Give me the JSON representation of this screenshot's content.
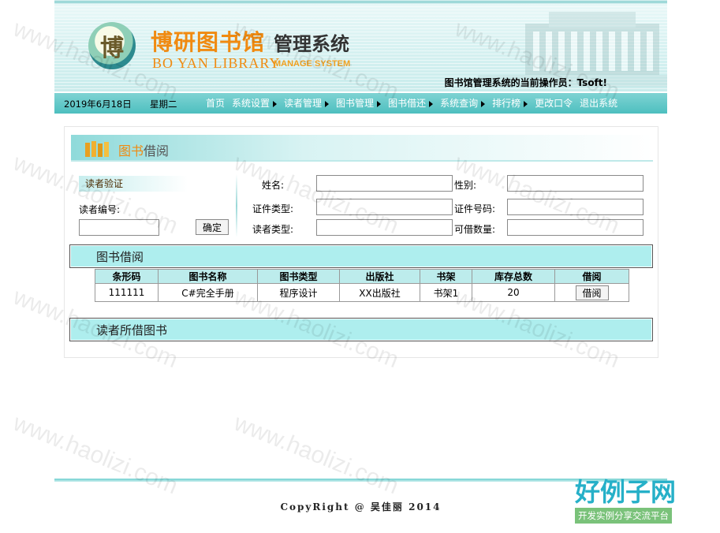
{
  "header": {
    "logo_seal": "博",
    "logo_cn": "博研图书馆",
    "logo_cn_suffix": "管理系统",
    "logo_en": "BO YAN LIBRARY",
    "logo_en_suffix": "MANAGE SYSTEM",
    "operator_text": "图书馆管理系统的当前操作员：Tsoft!"
  },
  "navbar": {
    "date": "2019年6月18日",
    "weekday": "星期二",
    "items": [
      {
        "label": "首页",
        "has_arrow": false
      },
      {
        "label": "系统设置",
        "has_arrow": true
      },
      {
        "label": "读者管理",
        "has_arrow": true
      },
      {
        "label": "图书管理",
        "has_arrow": true
      },
      {
        "label": "图书借还",
        "has_arrow": true
      },
      {
        "label": "系统查询",
        "has_arrow": true
      },
      {
        "label": "排行榜",
        "has_arrow": true
      },
      {
        "label": "更改口令",
        "has_arrow": false
      },
      {
        "label": "退出系统",
        "has_arrow": false
      }
    ]
  },
  "panel": {
    "title_highlight": "图书",
    "title_rest": "借阅"
  },
  "verify": {
    "title": "读者验证",
    "reader_id_label": "读者编号:",
    "reader_id_value": "",
    "confirm_label": "确定"
  },
  "reader_info": {
    "name_label": "姓名:",
    "gender_label": "性别:",
    "id_type_label": "证件类型:",
    "id_number_label": "证件号码:",
    "reader_type_label": "读者类型:",
    "borrowable_label": "可借数量:"
  },
  "borrow_section": {
    "title": "图书借阅",
    "columns": [
      "条形码",
      "图书名称",
      "图书类型",
      "出版社",
      "书架",
      "库存总数",
      "借阅"
    ],
    "rows": [
      {
        "barcode": "111111",
        "name": "C#完全手册",
        "type": "程序设计",
        "publisher": "XX出版社",
        "shelf": "书架1",
        "stock": "20",
        "action": "借阅"
      }
    ]
  },
  "borrowed_section": {
    "title": "读者所借图书"
  },
  "footer": {
    "copyright": "CopyRight @ 吴佳丽 2014"
  },
  "watermark": {
    "text": "www.haolizi.com",
    "brand_big": "好例子网",
    "brand_small": "开发实例分享交流平台"
  }
}
